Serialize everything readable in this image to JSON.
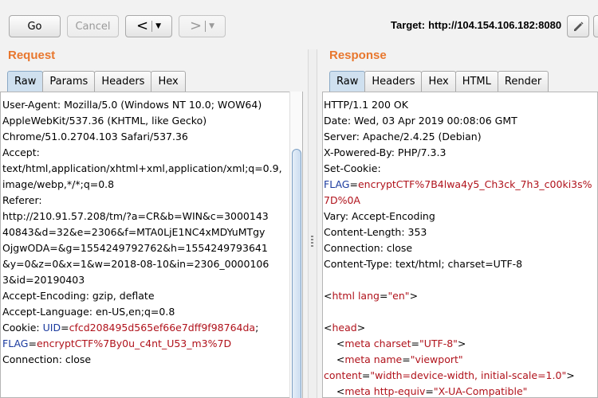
{
  "toolbar": {
    "go_label": "Go",
    "cancel_label": "Cancel",
    "back_glyph": "<",
    "forward_glyph": ">",
    "dropdown_glyph": "▼",
    "target_label": "Target:",
    "target_value": "http://104.154.106.182:8080"
  },
  "request": {
    "title": "Request",
    "tabs": [
      "Raw",
      "Params",
      "Headers",
      "Hex"
    ],
    "active_tab": "Raw",
    "lines": [
      "User-Agent: Mozilla/5.0 (Windows NT 10.0; WOW64)",
      "AppleWebKit/537.36 (KHTML, like Gecko)",
      "Chrome/51.0.2704.103 Safari/537.36",
      "Accept:",
      "text/html,application/xhtml+xml,application/xml;q=0.9,",
      "image/webp,*/*;q=0.8",
      "Referer:",
      "http://210.91.57.208/tm/?a=CR&b=WIN&c=3000143",
      "40843&d=32&e=2306&f=MTA0LjE1NC4xMDYuMTgy",
      "OjgwODA=&g=1554249792762&h=1554249793641",
      "&y=0&z=0&x=1&w=2018-08-10&in=2306_0000106",
      "3&id=20190403",
      "Accept-Encoding: gzip, deflate",
      "Accept-Language: en-US,en;q=0.8"
    ],
    "cookie_key": "Cookie: ",
    "uid_name": "UID",
    "uid_value": "cfcd208495d565ef66e7dff9f98764da",
    "flag_name": "FLAG",
    "flag_value": "encryptCTF%7By0u_c4nt_U53_m3%7D",
    "eq": "=",
    "semi": ";",
    "connection_line": "Connection: close"
  },
  "response": {
    "title": "Response",
    "tabs": [
      "Raw",
      "Headers",
      "Hex",
      "HTML",
      "Render"
    ],
    "active_tab": "Raw",
    "lines_top": [
      "HTTP/1.1 200 OK",
      "Date: Wed, 03 Apr 2019 00:08:06 GMT",
      "Server: Apache/2.4.25 (Debian)",
      "X-Powered-By: PHP/7.3.3",
      "Set-Cookie:"
    ],
    "flag_name": "FLAG",
    "flag_value_1": "encryptCTF%7B4lwa4y5_Ch3ck_7h3_c00ki3s%",
    "flag_value_2": "7D%0A",
    "lines_mid": [
      "Vary: Accept-Encoding",
      "Content-Length: 353",
      "Connection: close",
      "Content-Type: text/html; charset=UTF-8"
    ],
    "html": {
      "html_tag": "html",
      "lang_attr": "lang",
      "lang_val": "\"en\"",
      "head_tag": "head",
      "meta_tag": "meta",
      "charset_attr": "charset",
      "charset_val": "\"UTF-8\"",
      "name_attr": "name",
      "name_val": "\"viewport\"",
      "content_attr": "content",
      "content_val": "\"width=device-width, initial-scale=1.0\"",
      "httpequiv_attr": "http-equiv",
      "httpequiv_val": "\"X-UA-Compatible\""
    }
  },
  "colors": {
    "accent_orange": "#e8772e",
    "syntax_red": "#b0121b",
    "active_tab": "#cfe0ef"
  }
}
